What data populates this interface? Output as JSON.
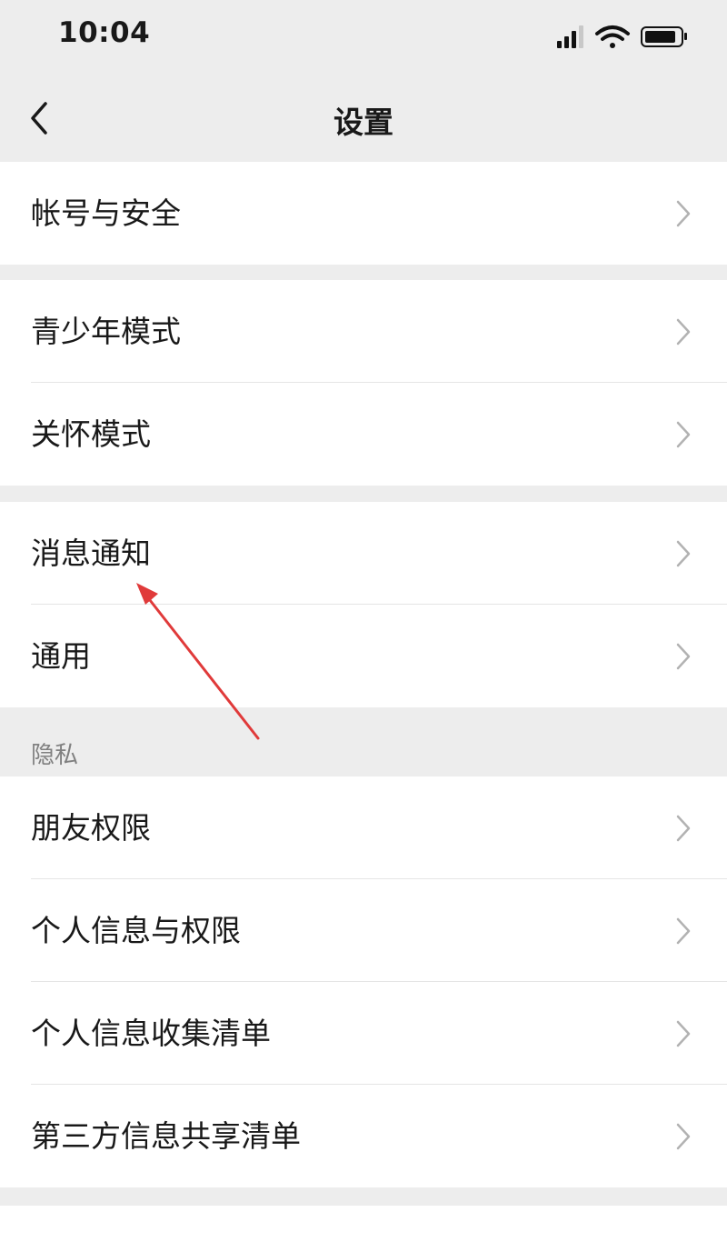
{
  "status_bar": {
    "time": "10:04",
    "icons": [
      "cellular-signal-icon",
      "wifi-icon",
      "battery-icon"
    ]
  },
  "nav": {
    "title": "设置",
    "back_icon": "chevron-left-icon"
  },
  "groups": [
    {
      "items": [
        {
          "label": "帐号与安全"
        }
      ]
    },
    {
      "items": [
        {
          "label": "青少年模式"
        },
        {
          "label": "关怀模式"
        }
      ]
    },
    {
      "items": [
        {
          "label": "消息通知"
        },
        {
          "label": "通用"
        }
      ]
    },
    {
      "section_title": "隐私",
      "items": [
        {
          "label": "朋友权限"
        },
        {
          "label": "个人信息与权限"
        },
        {
          "label": "个人信息收集清单"
        },
        {
          "label": "第三方信息共享清单"
        }
      ]
    }
  ],
  "annotation": {
    "type": "red-arrow",
    "points_to": "消息通知",
    "color": "#e03a3a"
  },
  "colors": {
    "background": "#ededed",
    "card": "#ffffff",
    "text": "#191919",
    "secondary_text": "#808080",
    "chevron": "#b2b2b2"
  }
}
